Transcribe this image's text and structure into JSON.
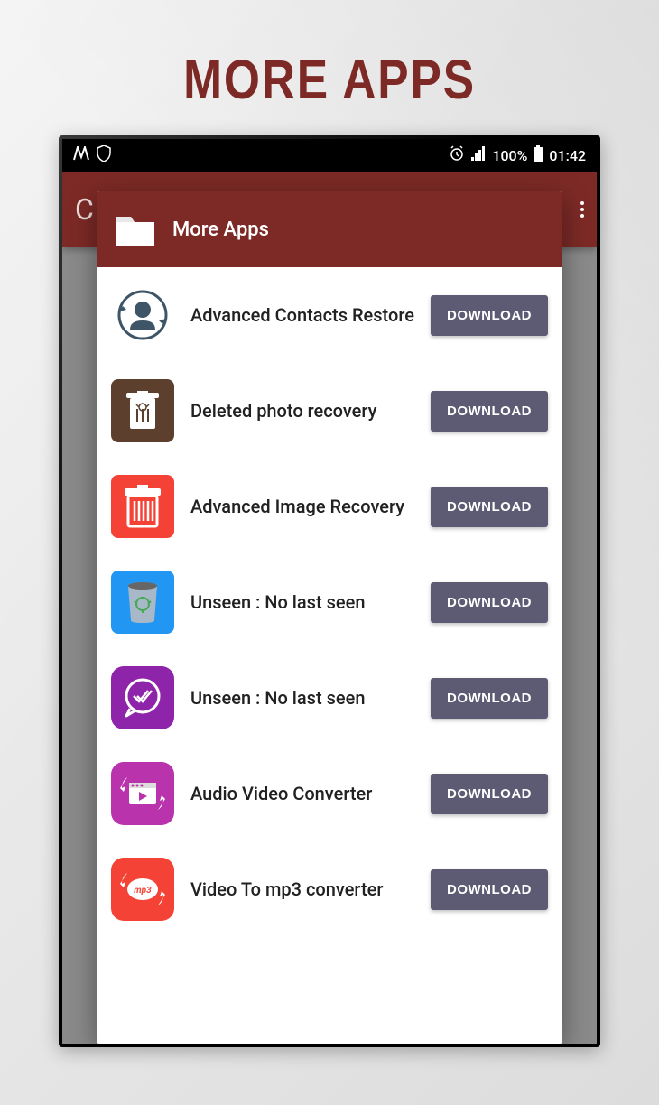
{
  "page": {
    "title": "MORE APPS"
  },
  "statusBar": {
    "battery": "100%",
    "time": "01:42"
  },
  "appHeader": {
    "initial": "C"
  },
  "dialog": {
    "title": "More Apps"
  },
  "apps": [
    {
      "name": "Advanced Contacts Restore",
      "button": "DOWNLOAD",
      "iconType": "contacts"
    },
    {
      "name": "Deleted photo recovery",
      "button": "DOWNLOAD",
      "iconType": "brown-trash"
    },
    {
      "name": "Advanced Image Recovery",
      "button": "DOWNLOAD",
      "iconType": "red-trash"
    },
    {
      "name": "Unseen : No last seen",
      "button": "DOWNLOAD",
      "iconType": "blue-bin"
    },
    {
      "name": "Unseen : No last seen",
      "button": "DOWNLOAD",
      "iconType": "purple-check"
    },
    {
      "name": "Audio Video Converter",
      "button": "DOWNLOAD",
      "iconType": "magenta-video"
    },
    {
      "name": "Video To mp3 converter",
      "button": "DOWNLOAD",
      "iconType": "red-mp3"
    }
  ]
}
